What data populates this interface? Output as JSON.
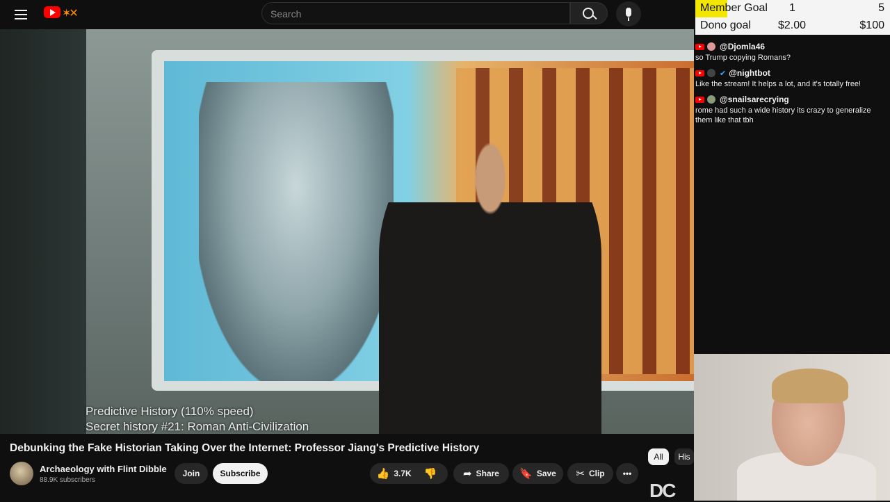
{
  "search": {
    "placeholder": "Search"
  },
  "video": {
    "caption_line1": "Predictive History (110% speed)",
    "caption_line2": "Secret history #21: Roman Anti-Civilization"
  },
  "info": {
    "title": "Debunking the Fake Historian Taking Over the Internet: Professor Jiang's Predictive History",
    "channel_name": "Archaeology with Flint Dibble",
    "subscribers": "88.9K subscribers",
    "join_label": "Join",
    "subscribe_label": "Subscribe",
    "like_count": "3.7K",
    "share_label": "Share",
    "save_label": "Save",
    "clip_label": "Clip",
    "more_label": "•••"
  },
  "chips": [
    "All",
    "His"
  ],
  "goals": {
    "member_label": "Member Goal",
    "member_current": "1",
    "member_target": "5",
    "dono_label": "Dono goal",
    "dono_current": "$2.00",
    "dono_target": "$100",
    "highlight_color": "#f3e600"
  },
  "chat": [
    {
      "user": "@Djomla46",
      "text": "so Trump copying Romans?"
    },
    {
      "user": "@nightbot",
      "text": "Like the stream! It helps a lot, and it's totally free!"
    },
    {
      "user": "@snailsarecrying",
      "text": "rome had such a wide history its crazy to generalize them like that tbh"
    }
  ],
  "icons": {
    "menu": "hamburger-icon",
    "search": "search-icon",
    "mic": "mic-icon",
    "like": "👍",
    "dislike": "👎",
    "share": "➦",
    "save": "🔖",
    "clip": "✂"
  },
  "brand_overlay": "DC"
}
